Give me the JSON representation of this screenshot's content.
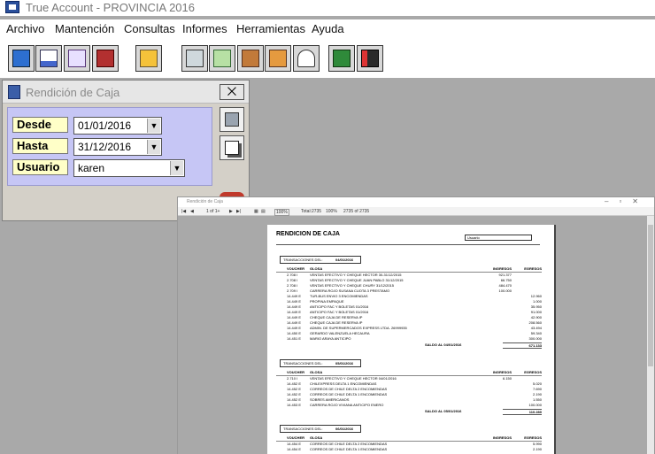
{
  "app": {
    "title": "True Account - PROVINCIA 2016"
  },
  "menu": [
    "Archivo",
    "Mantención",
    "Consultas",
    "Informes",
    "Herramientas",
    "Ayuda"
  ],
  "toolbar": {
    "buttons": [
      "deposit-icon",
      "document-icon",
      "report-icon",
      "bank-icon",
      "folder-icon",
      "calculator-icon",
      "ledger-icon",
      "notebook-icon",
      "list-icon",
      "user-icon",
      "eye-icon",
      "chart-icon"
    ]
  },
  "dialog": {
    "title": "Rendición de Caja",
    "close": "⨉",
    "fields": {
      "desde": {
        "label": "Desde",
        "value": "01/01/2016"
      },
      "hasta": {
        "label": "Hasta",
        "value": "31/12/2016"
      },
      "usuario": {
        "label": "Usuario",
        "value": "karen"
      }
    }
  },
  "preview": {
    "title": "Rendición de Caja",
    "toolbar": {
      "page": "1 of 1+",
      "zoom": "100%",
      "total": "Total:2735",
      "percent": "100%",
      "count": "2735 of 2735"
    },
    "report": {
      "title": "RENDICION DE CAJA",
      "usuario_label": "Usuario",
      "sec_label": "TRANSACCIONES DEL:",
      "col_voucher": "VOUCHER",
      "col_glosa": "GLOSA",
      "col_ingresos": "INGRESOS",
      "col_egresos": "EGRESOS",
      "saldo_label": "SALDO AL",
      "sections": [
        {
          "date": "04/01/2016",
          "rows": [
            {
              "voucher": "2.708 I",
              "glosa": "VENTAS EFECTIVO Y CHEQUE HECTOR 30-31/12/2015",
              "ingresos": "921.377",
              "egresos": ""
            },
            {
              "voucher": "2.708 I",
              "glosa": "VENTAS EFECTIVO Y CHEQUE JUAN PABLO 31/12/2015",
              "ingresos": "66.750",
              "egresos": ""
            },
            {
              "voucher": "2.708 I",
              "glosa": "VENTAS EFECTIVO Y CHEQUE CHURY 31/12/2015",
              "ingresos": "484.470",
              "egresos": ""
            },
            {
              "voucher": "2.709 I",
              "glosa": "CARRERA ROJO SUSANA CUOTA 3 PRESTAMO",
              "ingresos": "100.000",
              "egresos": ""
            },
            {
              "voucher": "14.449 E",
              "glosa": "TUR-BUS ENVIO 3 ENCOMIENDAS",
              "ingresos": "",
              "egresos": "12.960"
            },
            {
              "voucher": "14.449 E",
              "glosa": "PROPINA EMPAQUE",
              "ingresos": "",
              "egresos": "1.000"
            },
            {
              "voucher": "14.449 E",
              "glosa": "ANTICIPO FAC Y BOLETAS 01/2016",
              "ingresos": "",
              "egresos": "35.950"
            },
            {
              "voucher": "14.449 E",
              "glosa": "ANTICIPO FAC Y BOLETAS 01/2016",
              "ingresos": "",
              "egresos": "91.000"
            },
            {
              "voucher": "14.449 E",
              "glosa": "CHEQUE CAJA DE RESERVA IP",
              "ingresos": "",
              "egresos": "42.900"
            },
            {
              "voucher": "14.449 E",
              "glosa": "CHEQUE CAJA DE RESERVA IP",
              "ingresos": "",
              "egresos": "208.560"
            },
            {
              "voucher": "14.449 E",
              "glosa": "ADMIN. DE SUPERMERCADOS EXPRESS LTDA. 26999935",
              "ingresos": "",
              "egresos": "43.494"
            },
            {
              "voucher": "14.450 E",
              "glosa": "GERARDO VALENZUELA HECAURA",
              "ingresos": "",
              "egresos": "59.340"
            },
            {
              "voucher": "14.451 E",
              "glosa": "MARIO ARAYA ANTICIPO",
              "ingresos": "",
              "egresos": "300.000"
            }
          ],
          "saldo_date": "04/01/2016",
          "saldo_value": "671.133"
        },
        {
          "date": "05/01/2016",
          "rows": [
            {
              "voucher": "2.710 I",
              "glosa": "VENTAS EFECTIVO Y CHEQUE HECTOR 04/01/2016",
              "ingresos": "6.150",
              "egresos": ""
            },
            {
              "voucher": "14.452 E",
              "glosa": "CHILEXPRESS DELTA 1 ENCOMIENDAS",
              "ingresos": "",
              "egresos": "5.020"
            },
            {
              "voucher": "14.452 E",
              "glosa": "CORREOS DE CHILE DELTA 2 ENCOMIENDAS",
              "ingresos": "",
              "egresos": "7.690"
            },
            {
              "voucher": "14.452 E",
              "glosa": "CORREOS DE CHILE DELTA 1 ENCOMIENDAS",
              "ingresos": "",
              "egresos": "2.190"
            },
            {
              "voucher": "14.452 E",
              "glosa": "SOBRES AMERICANOS",
              "ingresos": "",
              "egresos": "1.550"
            },
            {
              "voucher": "14.453 E",
              "glosa": "CARRERA ROJO VIVIANA ANTICIPO ENERO",
              "ingresos": "",
              "egresos": "100.000"
            }
          ],
          "saldo_date": "05/01/2016",
          "saldo_value": "110.280"
        },
        {
          "date": "06/01/2016",
          "rows": [
            {
              "voucher": "14.454 E",
              "glosa": "CORREOS DE CHILE DELTA 2 ENCOMIENDAS",
              "ingresos": "",
              "egresos": "5.990"
            },
            {
              "voucher": "14.454 E",
              "glosa": "CORREOS DE CHILE DELTA 1 ENCOMIENDAS",
              "ingresos": "",
              "egresos": "2.190"
            }
          ],
          "saldo_date": "",
          "saldo_value": ""
        }
      ]
    }
  }
}
